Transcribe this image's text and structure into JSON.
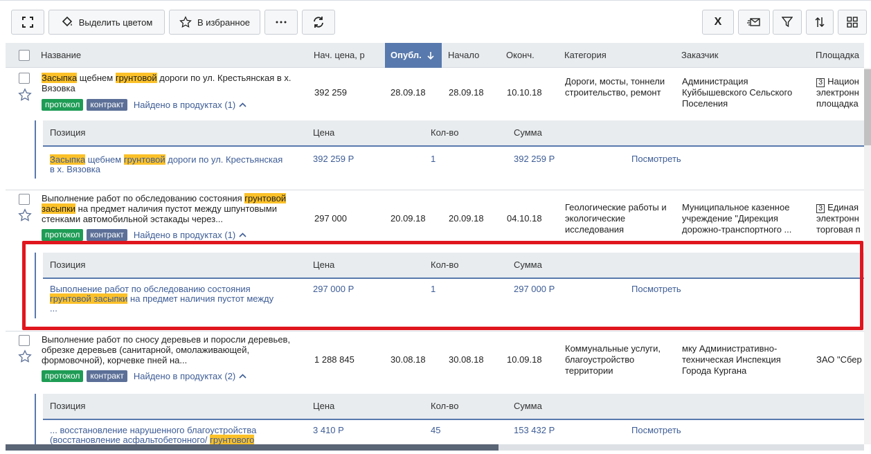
{
  "toolbar": {
    "highlight_label": "Выделить цветом",
    "favorite_label": "В избранное"
  },
  "columns": {
    "name": "Название",
    "price": "Нач. цена, р",
    "published": "Опубл.",
    "start": "Начало",
    "end": "Оконч.",
    "category": "Категория",
    "customer": "Заказчик",
    "platform": "Площадка"
  },
  "sub_columns": {
    "position": "Позиция",
    "price": "Цена",
    "qty": "Кол-во",
    "sum": "Сумма"
  },
  "tags": {
    "protocol": "протокол",
    "contract": "контракт"
  },
  "rows": [
    {
      "name_parts": [
        "Засыпка",
        " щебнем ",
        "грунтовой",
        " дороги по ул. Крестьянская в х. Вязовка"
      ],
      "found": "Найдено в продуктах (1)",
      "price": "392 259",
      "published": "28.09.18",
      "start": "28.09.18",
      "end": "10.10.18",
      "category": "Дороги, мосты, тоннели строительство, ремонт",
      "customer": "Администрация Куйбышевского Сельского Поселения",
      "platform_badge": "3",
      "platform": "Национ... электронн... площадка",
      "platform_l1": "Национ",
      "platform_l2": "электронн",
      "platform_l3": "площадка",
      "sub": {
        "pos_parts": [
          "Засыпка",
          " щебнем ",
          "грунтовой",
          " дороги по ул. Крестьянская в х. Вязовка"
        ],
        "price": "392 259 Р",
        "qty": "1",
        "sum": "392 259 Р",
        "action": "Посмотреть"
      }
    },
    {
      "name_parts": [
        "Выполнение работ по обследованию состояния ",
        "грунтовой засыпки",
        " на предмет наличия пустот между шпунтовыми стенками автомобильной эстакады через..."
      ],
      "found": "Найдено в продуктах (1)",
      "price": "297 000",
      "published": "20.09.18",
      "start": "20.09.18",
      "end": "04.10.18",
      "category": "Геологические работы и экологические исследования",
      "customer": "Муниципальное казенное учреждение \"Дирекция дорожно-транспортного ...",
      "platform_badge": "3",
      "platform_l1": "Единая",
      "platform_l2": "электронн",
      "platform_l3": "торговая п",
      "sub": {
        "pos_parts": [
          "Выполнение работ по обследованию состояния ",
          "грунтовой засыпки",
          " на предмет наличия пустот между ..."
        ],
        "price": "297 000 Р",
        "qty": "1",
        "sum": "297 000 Р",
        "action": "Посмотреть"
      }
    },
    {
      "name_parts": [
        "Выполнение работ по сносу деревьев и поросли деревьев, обрезке деревьев (санитарной, омолаживающей, формовочной), корчевке пней на..."
      ],
      "found": "Найдено в продуктах (2)",
      "price": "1 288 845",
      "published": "30.08.18",
      "start": "30.08.18",
      "end": "10.09.18",
      "category": "Коммунальные услуги, благоустройство территории",
      "customer": "мку Административно-техническая Инспекция Города Кургана",
      "platform": "ЗАО \"Сбер",
      "sub": {
        "pos_parts": [
          "... восстановление нарушенного благоустройства (восстановление асфальтобетонного/ ",
          "грунтового"
        ],
        "price": "3 410 Р",
        "qty": "45",
        "sum": "153 432 Р",
        "action": "Посмотреть"
      }
    }
  ],
  "icon_labels": {
    "excel": "X"
  }
}
